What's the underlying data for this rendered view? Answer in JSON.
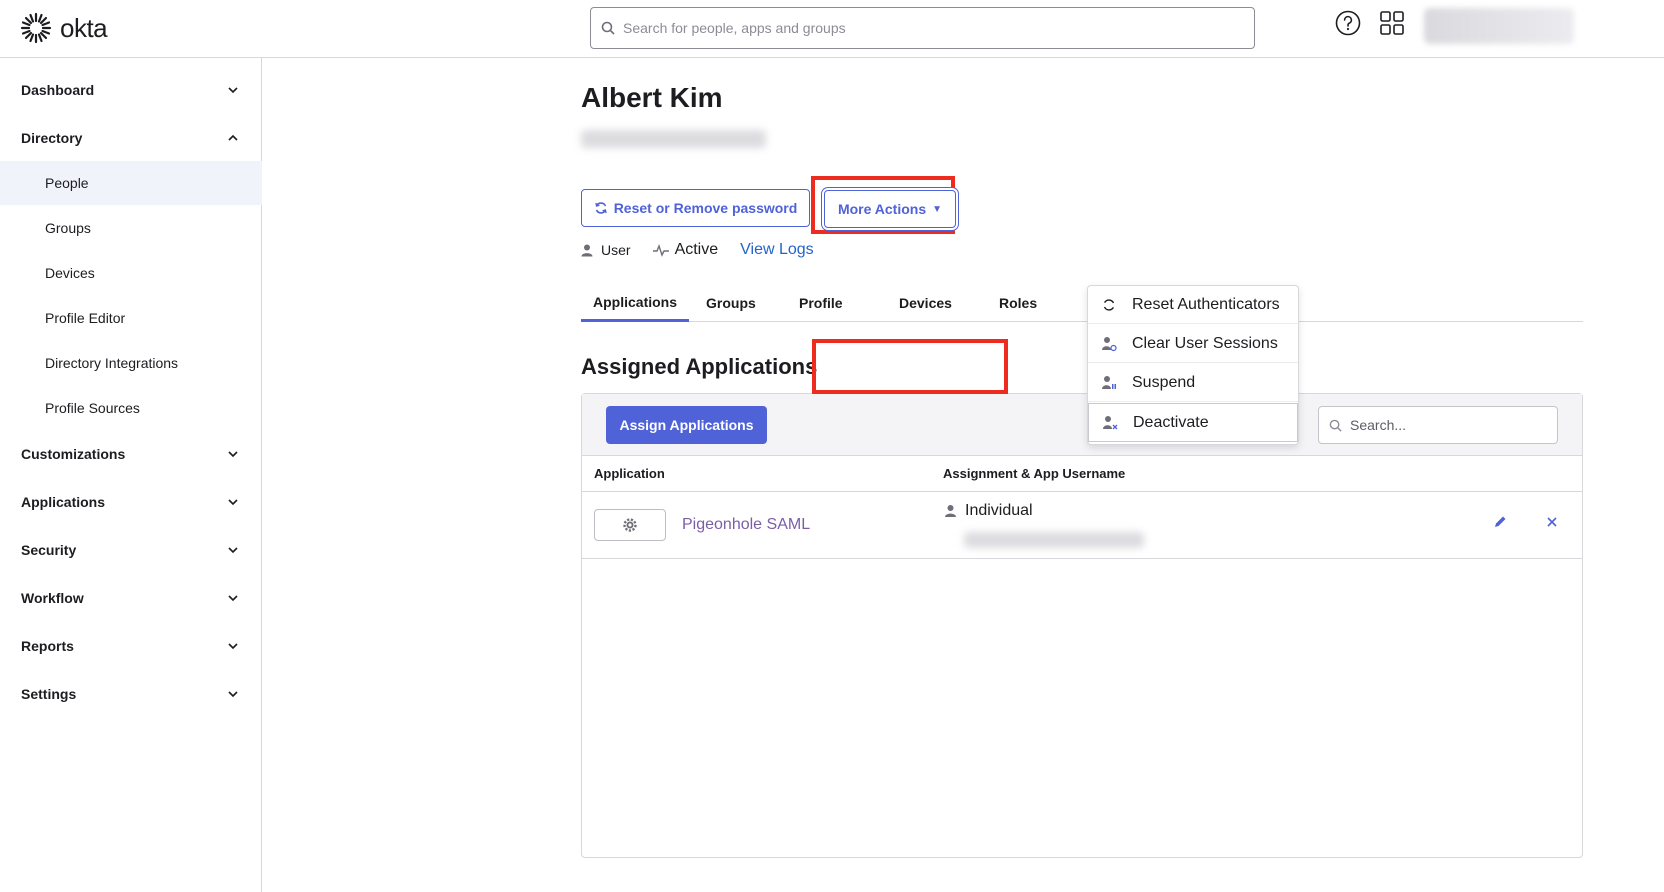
{
  "app": {
    "logo_text": "okta"
  },
  "header": {
    "search_placeholder": "Search for people, apps and groups"
  },
  "sidebar": {
    "sections": [
      {
        "label": "Dashboard",
        "expanded": false
      },
      {
        "label": "Directory",
        "expanded": true
      },
      {
        "label": "Customizations",
        "expanded": false
      },
      {
        "label": "Applications",
        "expanded": false
      },
      {
        "label": "Security",
        "expanded": false
      },
      {
        "label": "Workflow",
        "expanded": false
      },
      {
        "label": "Reports",
        "expanded": false
      },
      {
        "label": "Settings",
        "expanded": false
      }
    ],
    "directory_items": [
      {
        "label": "People",
        "active": true
      },
      {
        "label": "Groups",
        "active": false
      },
      {
        "label": "Devices",
        "active": false
      },
      {
        "label": "Profile Editor",
        "active": false
      },
      {
        "label": "Directory Integrations",
        "active": false
      },
      {
        "label": "Profile Sources",
        "active": false
      }
    ]
  },
  "profile": {
    "name": "Albert Kim",
    "reset_button": "Reset or Remove password",
    "more_actions_button": "More Actions",
    "type_label": "User",
    "status_label": "Active",
    "view_logs": "View Logs"
  },
  "tabs": [
    {
      "label": "Applications",
      "active": true
    },
    {
      "label": "Groups",
      "active": false
    },
    {
      "label": "Profile",
      "active": false
    },
    {
      "label": "Devices",
      "active": false
    },
    {
      "label": "Roles",
      "active": false
    }
  ],
  "assigned": {
    "title": "Assigned Applications",
    "assign_button": "Assign Applications",
    "search_placeholder": "Search...",
    "columns": [
      "Application",
      "Assignment & App Username"
    ],
    "rows": [
      {
        "app_name": "Pigeonhole SAML",
        "assignment": "Individual"
      }
    ]
  },
  "more_actions_menu": [
    {
      "label": "Reset Authenticators",
      "icon": "refresh-icon"
    },
    {
      "label": "Clear User Sessions",
      "icon": "user-session-icon"
    },
    {
      "label": "Suspend",
      "icon": "user-suspend-icon"
    },
    {
      "label": "Deactivate",
      "icon": "user-deactivate-icon"
    }
  ],
  "colors": {
    "accent": "#4f62d8",
    "annotation_red": "#ee2b1f",
    "link_purple": "#7b5ea7"
  }
}
